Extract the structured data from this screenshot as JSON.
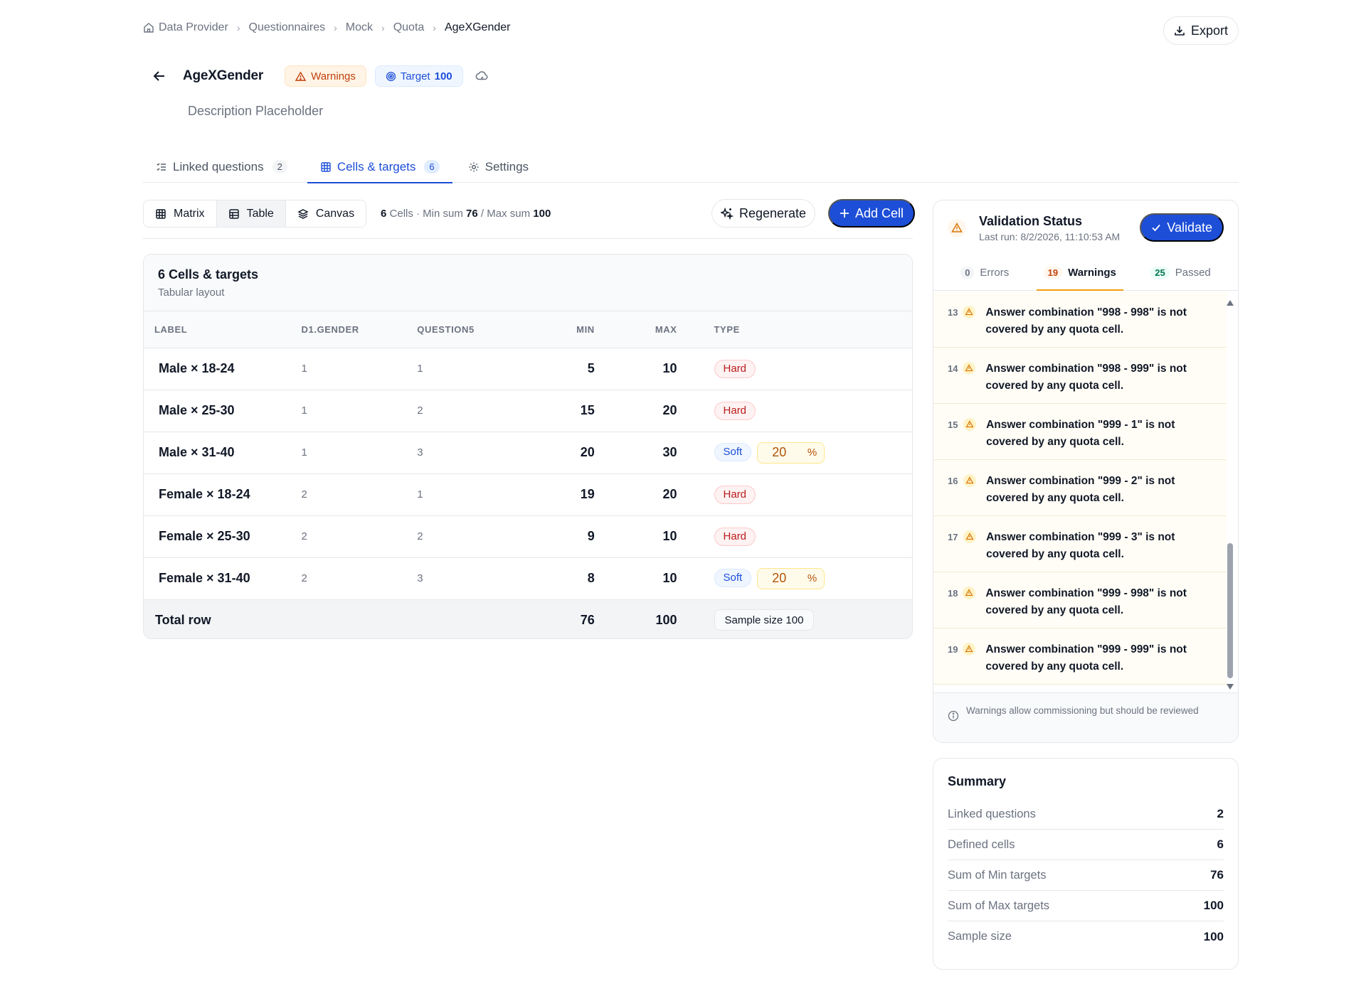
{
  "breadcrumb": {
    "items": [
      "Data Provider",
      "Questionnaires",
      "Mock",
      "Quota",
      "AgeXGender"
    ]
  },
  "header": {
    "export_label": "Export",
    "title": "AgeXGender",
    "warnings_badge": "Warnings",
    "target_label": "Target",
    "target_value": "100",
    "description": "Description Placeholder"
  },
  "tabs": [
    {
      "label": "Linked questions",
      "count": "2"
    },
    {
      "label": "Cells & targets",
      "count": "6"
    },
    {
      "label": "Settings"
    }
  ],
  "toolbar": {
    "views": [
      "Matrix",
      "Table",
      "Canvas"
    ],
    "active_view": "Table",
    "stats_cells": "6",
    "stats_cells_label": "Cells · Min sum",
    "stats_min": "76",
    "stats_sep": "/ Max sum",
    "stats_max": "100",
    "regenerate_label": "Regenerate",
    "add_cell_label": "Add Cell"
  },
  "table": {
    "title": "6 Cells & targets",
    "subtitle": "Tabular layout",
    "columns": [
      "LABEL",
      "D1.GENDER",
      "QUESTION5",
      "MIN",
      "MAX",
      "TYPE"
    ],
    "rows": [
      {
        "label": "Male × 18-24",
        "gender": "1",
        "q5": "1",
        "min": "5",
        "max": "10",
        "type": "Hard"
      },
      {
        "label": "Male × 25-30",
        "gender": "1",
        "q5": "2",
        "min": "15",
        "max": "20",
        "type": "Hard"
      },
      {
        "label": "Male × 31-40",
        "gender": "1",
        "q5": "3",
        "min": "20",
        "max": "30",
        "type": "Soft",
        "pct": "20",
        "pct_unit": "%"
      },
      {
        "label": "Female × 18-24",
        "gender": "2",
        "q5": "1",
        "min": "19",
        "max": "20",
        "type": "Hard"
      },
      {
        "label": "Female × 25-30",
        "gender": "2",
        "q5": "2",
        "min": "9",
        "max": "10",
        "type": "Hard"
      },
      {
        "label": "Female × 31-40",
        "gender": "2",
        "q5": "3",
        "min": "8",
        "max": "10",
        "type": "Soft",
        "pct": "20",
        "pct_unit": "%"
      }
    ],
    "total": {
      "label": "Total row",
      "min": "76",
      "max": "100",
      "sample": "Sample size 100"
    }
  },
  "validation": {
    "title": "Validation Status",
    "last_run": "Last run: 8/2/2026, 11:10:53 AM",
    "validate_label": "Validate",
    "tabs": [
      {
        "count": "0",
        "label": "Errors"
      },
      {
        "count": "19",
        "label": "Warnings"
      },
      {
        "count": "25",
        "label": "Passed"
      }
    ],
    "issues": [
      {
        "idx": "13",
        "msg": "Answer combination \"998 - 998\" is not covered by any quota cell."
      },
      {
        "idx": "14",
        "msg": "Answer combination \"998 - 999\" is not covered by any quota cell."
      },
      {
        "idx": "15",
        "msg": "Answer combination \"999 - 1\" is not covered by any quota cell."
      },
      {
        "idx": "16",
        "msg": "Answer combination \"999 - 2\" is not covered by any quota cell."
      },
      {
        "idx": "17",
        "msg": "Answer combination \"999 - 3\" is not covered by any quota cell."
      },
      {
        "idx": "18",
        "msg": "Answer combination \"999 - 998\" is not covered by any quota cell."
      },
      {
        "idx": "19",
        "msg": "Answer combination \"999 - 999\" is not covered by any quota cell."
      }
    ],
    "footer": "Warnings allow commissioning but should be reviewed"
  },
  "summary": {
    "title": "Summary",
    "rows": [
      {
        "k": "Linked questions",
        "v": "2"
      },
      {
        "k": "Defined cells",
        "v": "6"
      },
      {
        "k": "Sum of Min targets",
        "v": "76"
      },
      {
        "k": "Sum of Max targets",
        "v": "100"
      },
      {
        "k": "Sample size",
        "v": "100"
      }
    ]
  },
  "colors": {
    "accent": "#1d4ed8",
    "warning": "#c2410c",
    "hard": "#b91c1c",
    "soft": "#1d4ed8"
  }
}
